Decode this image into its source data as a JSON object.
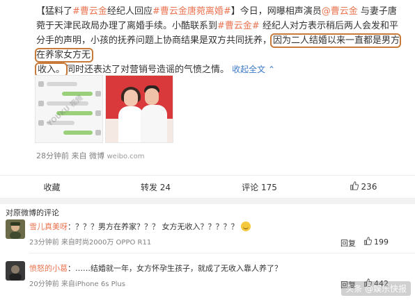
{
  "post": {
    "text_start": "【",
    "text_s1": "猛料了",
    "text_tag1": "#曹云金",
    "text_s2": "经纪人回应",
    "text_tag2": "#曹云金唐菀离婚#",
    "text_s3": "】今日，网曝相声演员",
    "text_mention": "@曹云金",
    "text_s4": " 与妻子唐菀于天津民政局办理了离婚手续。小酷联系到",
    "text_tag3": "#曹云金#",
    "text_s5": " 经纪人对方表示稍后两人会发和平分手的声明，小孩的抚养问题上协商结果是双方共同抚养，",
    "text_highlight1": "因为二人结婚以来一直都是男方在养家女方无",
    "text_highlight2": "收入。",
    "text_s6": "同时还表达了对营销号造谣的气愤之情。",
    "more_label": "收起全文 ⌃",
    "watermark": "YOUKU 视频",
    "time": "28分钟前",
    "source_prefix": "来自",
    "source": "微博",
    "link": "weibo.com"
  },
  "actions": {
    "collect_label": "收藏",
    "repost_label": "转发 24",
    "comment_label": "评论 175",
    "like_count": "236"
  },
  "comments": {
    "title": "对原微博的评论",
    "items": [
      {
        "name": "雪儿真美呀",
        "text": "：？？？男方在养家？？？ 女方无收入？？？？？",
        "time": "23分钟前",
        "source": "来自时尚2000万 OPPO R11",
        "reply_label": "回复",
        "likes": "199"
      },
      {
        "name": "愤怒的小葛",
        "text": "：……结婚就一年，女方怀孕生孩子，就成了无收入靠人养了？",
        "time": "20分钟前",
        "source": "来自iPhone 6s Plus",
        "reply_label": "回复",
        "likes": "442"
      }
    ]
  },
  "corner_watermark": "头条 @娱乐快报"
}
